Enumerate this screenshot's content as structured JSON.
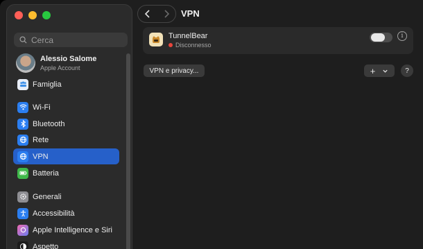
{
  "window": {
    "title": "VPN"
  },
  "sidebar": {
    "search_placeholder": "Cerca",
    "account": {
      "name": "Alessio Salome",
      "subtitle": "Apple Account"
    },
    "items": [
      {
        "label": "Famiglia",
        "icon": "family-icon",
        "color": "#e8eef8"
      },
      {
        "label": "Wi-Fi",
        "icon": "wifi-icon",
        "color": "#2b7ef0"
      },
      {
        "label": "Bluetooth",
        "icon": "bluetooth-icon",
        "color": "#2b7ef0"
      },
      {
        "label": "Rete",
        "icon": "globe-icon",
        "color": "#2b7ef0"
      },
      {
        "label": "VPN",
        "icon": "vpn-globe-icon",
        "color": "#2b7ef0",
        "active": true
      },
      {
        "label": "Batteria",
        "icon": "battery-icon",
        "color": "#3fb84a"
      },
      {
        "label": "Generali",
        "icon": "gear-icon",
        "color": "#8e8e93"
      },
      {
        "label": "Accessibilità",
        "icon": "accessibility-icon",
        "color": "#2b7ef0"
      },
      {
        "label": "Apple Intelligence e Siri",
        "icon": "siri-icon",
        "color": "#b05be0"
      },
      {
        "label": "Aspetto",
        "icon": "appearance-icon",
        "color": "#1c1c1c"
      }
    ]
  },
  "main": {
    "vpn": {
      "name": "TunnelBear",
      "status": "Disconnesso",
      "status_color": "#e8453c",
      "enabled": false
    },
    "privacy_button": "VPN e privacy...",
    "add_button": "+",
    "help_button": "?"
  }
}
